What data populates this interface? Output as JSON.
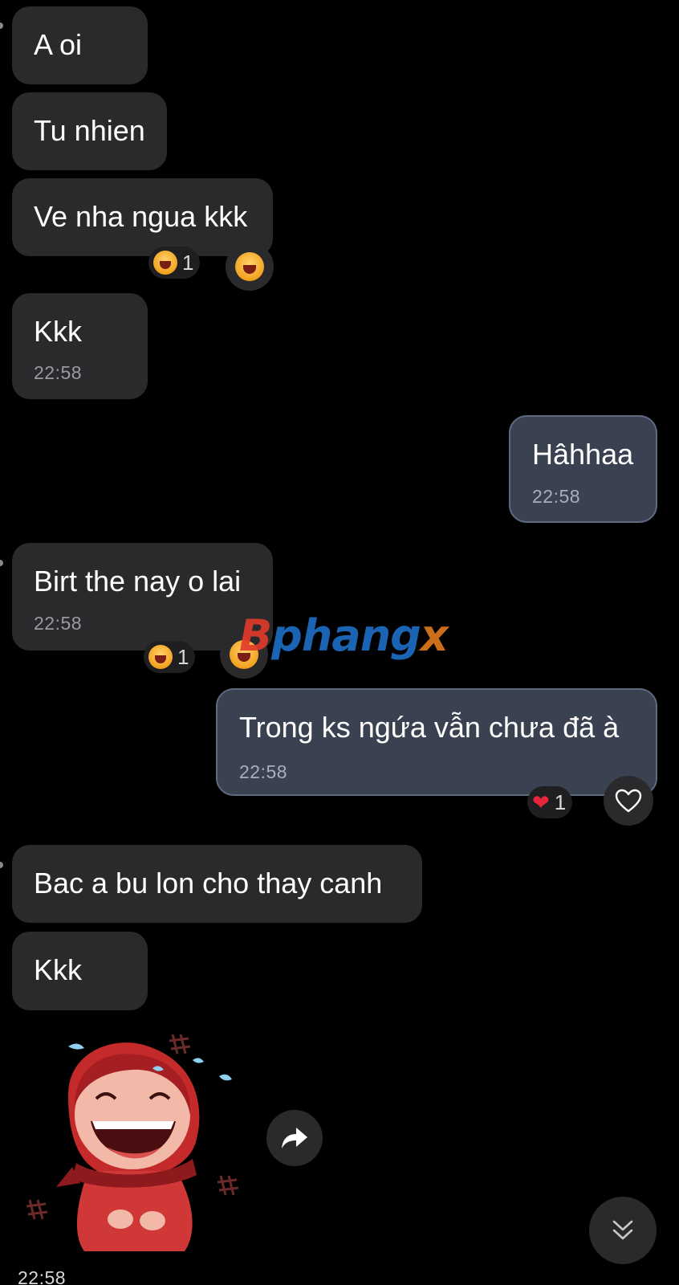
{
  "messages": {
    "m1": {
      "text": "A oi"
    },
    "m2": {
      "text": "Tu nhien"
    },
    "m3": {
      "text": "Ve nha ngua kkk",
      "reaction": {
        "emoji_icon": "laughing-emoji",
        "count": "1"
      }
    },
    "m4": {
      "text": "Kkk",
      "time": "22:58"
    },
    "m5": {
      "text": "Hâhhaa",
      "time": "22:58"
    },
    "m6": {
      "text": "Birt the nay o lai",
      "time": "22:58",
      "reaction": {
        "emoji_icon": "laughing-emoji",
        "count": "1"
      }
    },
    "m7": {
      "text": "Trong ks ngứa vẫn chưa đã à",
      "time": "22:58",
      "reaction": {
        "emoji_icon": "red-heart-emoji",
        "count": "1"
      }
    },
    "m8": {
      "text": "Bac a bu lon cho thay canh"
    },
    "m9": {
      "text": "Kkk"
    },
    "sticker": {
      "name": "crying-laughing-girl-sticker",
      "time": "22:58"
    }
  },
  "watermark": {
    "first": "B",
    "middle": "phang",
    "last": "x"
  },
  "icons": {
    "forward": "share-arrow-icon",
    "scroll_down": "double-chevron-down-icon",
    "add_reaction_heart": "heart-outline-icon"
  },
  "colors": {
    "background": "#000000",
    "incoming_bubble": "#2a2a2c",
    "outgoing_bubble": "#3a4150",
    "outgoing_border": "#5c6a82",
    "timestamp": "#9a9a9f"
  }
}
